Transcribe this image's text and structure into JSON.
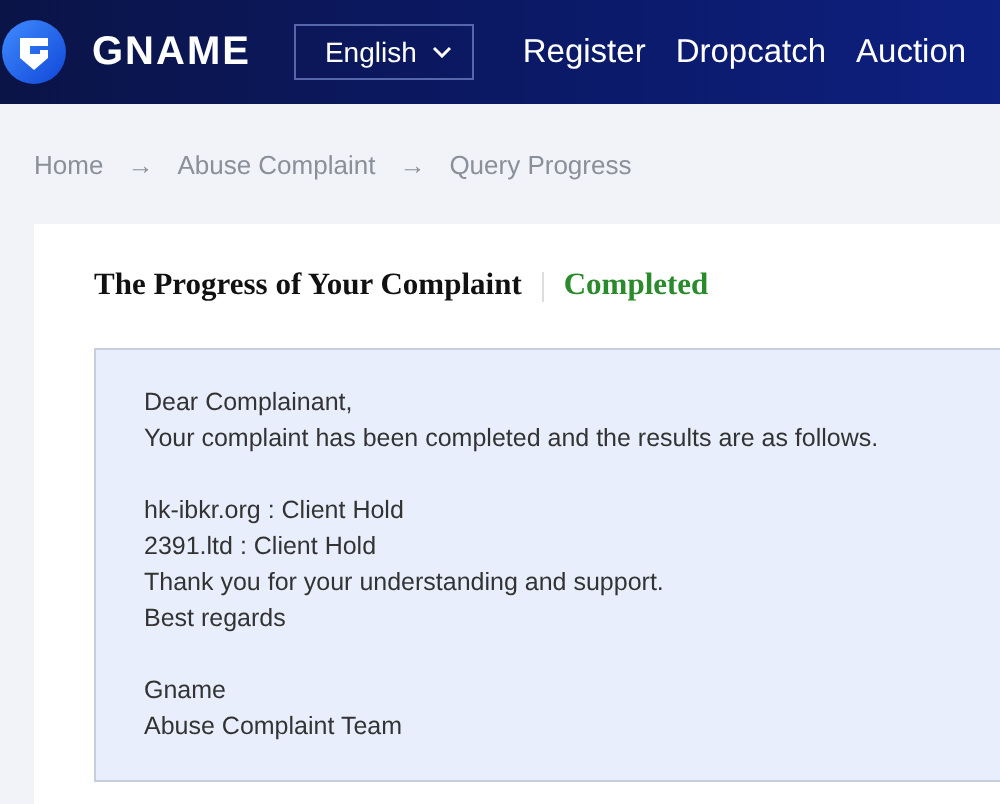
{
  "header": {
    "brand": "GNAME",
    "language": "English",
    "nav": [
      {
        "label": "Register"
      },
      {
        "label": "Dropcatch"
      },
      {
        "label": "Auction"
      }
    ]
  },
  "breadcrumb": [
    {
      "kind": "link",
      "text": "Home"
    },
    {
      "kind": "sep",
      "text": "→"
    },
    {
      "kind": "link",
      "text": "Abuse Complaint"
    },
    {
      "kind": "sep",
      "text": "→"
    },
    {
      "kind": "current",
      "text": "Query Progress"
    }
  ],
  "title": "The Progress of Your Complaint",
  "status": "Completed",
  "message": [
    [
      "Dear Complainant,",
      "Your complaint has been completed and the results are as follows."
    ],
    [
      "hk-ibkr.org : Client Hold",
      "2391.ltd : Client Hold",
      "Thank you for your understanding and support.",
      "Best regards"
    ],
    [
      "Gname",
      "Abuse Complaint Team"
    ]
  ]
}
